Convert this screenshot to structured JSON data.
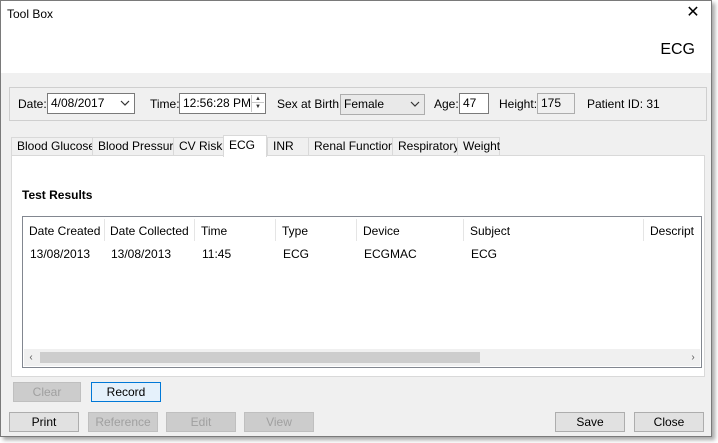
{
  "window": {
    "title": "Tool Box",
    "header_title": "ECG",
    "close_glyph": "✕"
  },
  "toolbar": {
    "date_label": "Date:",
    "date_value": "4/08/2017",
    "time_label": "Time:",
    "time_value": "12:56:28 PM",
    "sex_label": "Sex at Birth:",
    "sex_value": "Female",
    "age_label": "Age:",
    "age_value": "47",
    "height_label": "Height:",
    "height_value": "175",
    "patient_id": "Patient ID: 31"
  },
  "tabs": [
    {
      "label": "Blood Glucose"
    },
    {
      "label": "Blood Pressure"
    },
    {
      "label": "CV Risk"
    },
    {
      "label": "ECG"
    },
    {
      "label": "INR"
    },
    {
      "label": "Renal Function"
    },
    {
      "label": "Respiratory"
    },
    {
      "label": "Weight"
    }
  ],
  "active_tab": "ECG",
  "panel": {
    "section_title": "Test Results",
    "columns": [
      "Date Created",
      "Date Collected",
      "Time",
      "Type",
      "Device",
      "Subject",
      "Descript"
    ],
    "rows": [
      [
        "13/08/2013",
        "13/08/2013",
        "11:45",
        "ECG",
        "ECGMAC",
        "ECG",
        ""
      ]
    ]
  },
  "buttons": {
    "clear": "Clear",
    "record": "Record",
    "print": "Print",
    "reference": "Reference",
    "edit": "Edit",
    "view": "View",
    "save": "Save",
    "close": "Close"
  },
  "icons": {
    "dropdown": "chevron-down-icon",
    "spin_up": "▲",
    "spin_down": "▼",
    "scroll_left": "‹",
    "scroll_right": "›"
  }
}
